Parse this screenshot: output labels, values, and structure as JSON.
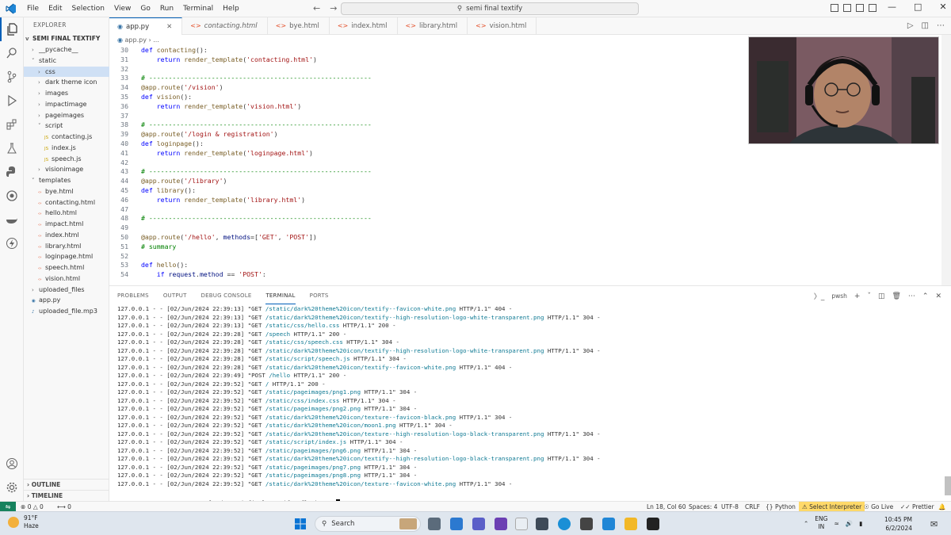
{
  "window": {
    "search_text": "semi final textify",
    "menu": [
      "File",
      "Edit",
      "Selection",
      "View",
      "Go",
      "Run",
      "Terminal",
      "Help"
    ]
  },
  "sidebar": {
    "header": "EXPLORER",
    "project": "SEMI FINAL TEXTIFY",
    "items": [
      {
        "label": "__pycache__",
        "depth": 1,
        "chevron": ">"
      },
      {
        "label": "static",
        "depth": 1,
        "chevron": "v"
      },
      {
        "label": "css",
        "depth": 2,
        "chevron": ">"
      },
      {
        "label": "dark theme icon",
        "depth": 2,
        "chevron": ">"
      },
      {
        "label": "images",
        "depth": 2,
        "chevron": ">"
      },
      {
        "label": "impactimage",
        "depth": 2,
        "chevron": ">"
      },
      {
        "label": "pageimages",
        "depth": 2,
        "chevron": ">"
      },
      {
        "label": "script",
        "depth": 2,
        "chevron": "v"
      },
      {
        "label": "contacting.js",
        "depth": 3,
        "chevron": ""
      },
      {
        "label": "index.js",
        "depth": 3,
        "chevron": ""
      },
      {
        "label": "speech.js",
        "depth": 3,
        "chevron": ""
      },
      {
        "label": "visionimage",
        "depth": 2,
        "chevron": ">"
      },
      {
        "label": "templates",
        "depth": 1,
        "chevron": "v"
      },
      {
        "label": "bye.html",
        "depth": 2,
        "chevron": ""
      },
      {
        "label": "contacting.html",
        "depth": 2,
        "chevron": ""
      },
      {
        "label": "hello.html",
        "depth": 2,
        "chevron": ""
      },
      {
        "label": "impact.html",
        "depth": 2,
        "chevron": ""
      },
      {
        "label": "index.html",
        "depth": 2,
        "chevron": ""
      },
      {
        "label": "library.html",
        "depth": 2,
        "chevron": ""
      },
      {
        "label": "loginpage.html",
        "depth": 2,
        "chevron": ""
      },
      {
        "label": "speech.html",
        "depth": 2,
        "chevron": ""
      },
      {
        "label": "vision.html",
        "depth": 2,
        "chevron": ""
      },
      {
        "label": "uploaded_files",
        "depth": 1,
        "chevron": ">"
      },
      {
        "label": "app.py",
        "depth": 1,
        "chevron": ""
      },
      {
        "label": "uploaded_file.mp3",
        "depth": 1,
        "chevron": ""
      }
    ],
    "outline": "OUTLINE",
    "timeline": "TIMELINE"
  },
  "tabs": [
    {
      "label": "app.py"
    },
    {
      "label": "contacting.html"
    },
    {
      "label": "bye.html"
    },
    {
      "label": "index.html"
    },
    {
      "label": "library.html"
    },
    {
      "label": "vision.html"
    }
  ],
  "breadcrumb": {
    "file": "app.py",
    "rest": "..."
  },
  "code": [
    {
      "n": "30",
      "html": "<span class='kw'>def</span> <span class='fn'>contacting</span>():"
    },
    {
      "n": "31",
      "html": "    <span class='kw'>return</span> <span class='fn'>render_template</span>(<span class='str'>'contacting.html'</span>)"
    },
    {
      "n": "32",
      "html": ""
    },
    {
      "n": "33",
      "html": "<span class='cm'># ---------------------------------------------------------</span>"
    },
    {
      "n": "34",
      "html": "<span class='dec'>@app.route</span>(<span class='str'>'/vision'</span>)"
    },
    {
      "n": "35",
      "html": "<span class='kw'>def</span> <span class='fn'>vision</span>():"
    },
    {
      "n": "36",
      "html": "    <span class='kw'>return</span> <span class='fn'>render_template</span>(<span class='str'>'vision.html'</span>)"
    },
    {
      "n": "37",
      "html": ""
    },
    {
      "n": "38",
      "html": "<span class='cm'># ---------------------------------------------------------</span>"
    },
    {
      "n": "39",
      "html": "<span class='dec'>@app.route</span>(<span class='str'>'/login &amp; registration'</span>)"
    },
    {
      "n": "40",
      "html": "<span class='kw'>def</span> <span class='fn'>loginpage</span>():"
    },
    {
      "n": "41",
      "html": "    <span class='kw'>return</span> <span class='fn'>render_template</span>(<span class='str'>'loginpage.html'</span>)"
    },
    {
      "n": "42",
      "html": ""
    },
    {
      "n": "43",
      "html": "<span class='cm'># ---------------------------------------------------------</span>"
    },
    {
      "n": "44",
      "html": "<span class='dec'>@app.route</span>(<span class='str'>'/library'</span>)"
    },
    {
      "n": "45",
      "html": "<span class='kw'>def</span> <span class='fn'>library</span>():"
    },
    {
      "n": "46",
      "html": "    <span class='kw'>return</span> <span class='fn'>render_template</span>(<span class='str'>'library.html'</span>)"
    },
    {
      "n": "47",
      "html": ""
    },
    {
      "n": "48",
      "html": "<span class='cm'># ---------------------------------------------------------</span>"
    },
    {
      "n": "49",
      "html": ""
    },
    {
      "n": "50",
      "html": "<span class='dec'>@app.route</span>(<span class='str'>'/hello'</span>, <span class='pl'>methods</span>=[<span class='str'>'GET'</span>, <span class='str'>'POST'</span>])"
    },
    {
      "n": "51",
      "html": "<span class='cm'># summary</span>"
    },
    {
      "n": "52",
      "html": ""
    },
    {
      "n": "53",
      "html": "<span class='kw'>def</span> <span class='fn'>hello</span>():"
    },
    {
      "n": "54",
      "html": "    <span class='kw'>if</span> <span class='pl'>request</span>.<span class='pl'>method</span> == <span class='str'>'POST'</span>:"
    }
  ],
  "panel": {
    "tabs": [
      "PROBLEMS",
      "OUTPUT",
      "DEBUG CONSOLE",
      "TERMINAL",
      "PORTS"
    ],
    "active_tab": "TERMINAL",
    "shell": "pwsh"
  },
  "terminal": [
    {
      "pre": "127.0.0.1 - - [02/Jun/2024 22:39:13] \"GET ",
      "path": "/static/dark%20theme%20icon/textify--favicon-white.png",
      "post": " HTTP/1.1\" 404 -"
    },
    {
      "pre": "127.0.0.1 - - [02/Jun/2024 22:39:13] \"GET ",
      "path": "/static/dark%20theme%20icon/textify--high-resolution-logo-white-transparent.png",
      "post": " HTTP/1.1\" 304 -"
    },
    {
      "pre": "127.0.0.1 - - [02/Jun/2024 22:39:13] \"GET ",
      "path": "/static/css/hello.css",
      "post": " HTTP/1.1\" 200 -"
    },
    {
      "pre": "127.0.0.1 - - [02/Jun/2024 22:39:28] \"GET ",
      "path": "/speech",
      "post": " HTTP/1.1\" 200 -"
    },
    {
      "pre": "127.0.0.1 - - [02/Jun/2024 22:39:28] \"GET ",
      "path": "/static/css/speech.css",
      "post": " HTTP/1.1\" 304 -"
    },
    {
      "pre": "127.0.0.1 - - [02/Jun/2024 22:39:28] \"GET ",
      "path": "/static/dark%20theme%20icon/textify--high-resolution-logo-white-transparent.png",
      "post": " HTTP/1.1\" 304 -"
    },
    {
      "pre": "127.0.0.1 - - [02/Jun/2024 22:39:28] \"GET ",
      "path": "/static/script/speech.js",
      "post": " HTTP/1.1\" 304 -"
    },
    {
      "pre": "127.0.0.1 - - [02/Jun/2024 22:39:28] \"GET ",
      "path": "/static/dark%20theme%20icon/textify--favicon-white.png",
      "post": " HTTP/1.1\" 404 -"
    },
    {
      "pre": "127.0.0.1 - - [02/Jun/2024 22:39:49] \"POST ",
      "path": "/hello",
      "post": " HTTP/1.1\" 200 -"
    },
    {
      "pre": "127.0.0.1 - - [02/Jun/2024 22:39:52] \"GET ",
      "path": "/",
      "post": " HTTP/1.1\" 200 -"
    },
    {
      "pre": "127.0.0.1 - - [02/Jun/2024 22:39:52] \"GET ",
      "path": "/static/pageimages/png1.png",
      "post": " HTTP/1.1\" 304 -"
    },
    {
      "pre": "127.0.0.1 - - [02/Jun/2024 22:39:52] \"GET ",
      "path": "/static/css/index.css",
      "post": " HTTP/1.1\" 304 -"
    },
    {
      "pre": "127.0.0.1 - - [02/Jun/2024 22:39:52] \"GET ",
      "path": "/static/pageimages/png2.png",
      "post": " HTTP/1.1\" 304 -"
    },
    {
      "pre": "127.0.0.1 - - [02/Jun/2024 22:39:52] \"GET ",
      "path": "/static/dark%20theme%20icon/texture--favicon-black.png",
      "post": " HTTP/1.1\" 304 -"
    },
    {
      "pre": "127.0.0.1 - - [02/Jun/2024 22:39:52] \"GET ",
      "path": "/static/dark%20theme%20icon/moon1.png",
      "post": " HTTP/1.1\" 304 -"
    },
    {
      "pre": "127.0.0.1 - - [02/Jun/2024 22:39:52] \"GET ",
      "path": "/static/dark%20theme%20icon/texture--high-resolution-logo-black-transparent.png",
      "post": " HTTP/1.1\" 304 -"
    },
    {
      "pre": "127.0.0.1 - - [02/Jun/2024 22:39:52] \"GET ",
      "path": "/static/script/index.js",
      "post": " HTTP/1.1\" 304 -"
    },
    {
      "pre": "127.0.0.1 - - [02/Jun/2024 22:39:52] \"GET ",
      "path": "/static/pageimages/png6.png",
      "post": " HTTP/1.1\" 304 -"
    },
    {
      "pre": "127.0.0.1 - - [02/Jun/2024 22:39:52] \"GET ",
      "path": "/static/dark%20theme%20icon/textify--high-resolution-logo-black-transparent.png",
      "post": " HTTP/1.1\" 304 -"
    },
    {
      "pre": "127.0.0.1 - - [02/Jun/2024 22:39:52] \"GET ",
      "path": "/static/pageimages/png7.png",
      "post": " HTTP/1.1\" 304 -"
    },
    {
      "pre": "127.0.0.1 - - [02/Jun/2024 22:39:52] \"GET ",
      "path": "/static/pageimages/png8.png",
      "post": " HTTP/1.1\" 304 -"
    },
    {
      "pre": "127.0.0.1 - - [02/Jun/2024 22:39:52] \"GET ",
      "path": "/static/dark%20theme%20icon/texture--favicon-white.png",
      "post": " HTTP/1.1\" 304 -"
    }
  ],
  "prompt": "PS C:\\Users\\yourr\\Downloads\\semi final textify> flask run ",
  "status": {
    "errors": "0",
    "warnings": "0",
    "ports": "0",
    "position": "Ln 18, Col 60",
    "spaces": "Spaces: 4",
    "encoding": "UTF-8",
    "eol": "CRLF",
    "language": "Python",
    "interpreter": "Select Interpreter",
    "golive": "Go Live",
    "prettier": "Prettier"
  },
  "taskbar": {
    "temp": "91°F",
    "weather": "Haze",
    "search": "Search",
    "lang1": "ENG",
    "lang2": "IN",
    "time": "10:45 PM",
    "date": "6/2/2024"
  },
  "colors": {
    "accent": "#005fb8",
    "remote": "#16825d",
    "interpreter_bg": "#ffd969",
    "path": "#0f7a94"
  }
}
